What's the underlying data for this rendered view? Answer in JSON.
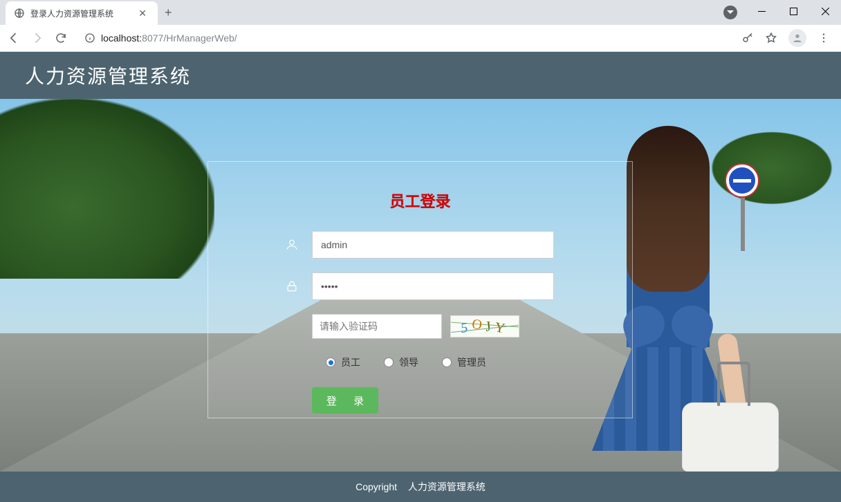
{
  "browser": {
    "tab_title": "登录人力资源管理系统",
    "url_host": "localhost:",
    "url_port": "8077",
    "url_path": "/HrManagerWeb/"
  },
  "header": {
    "title": "人力资源管理系统"
  },
  "login": {
    "title": "员工登录",
    "username_value": "admin",
    "password_value": "•••••",
    "captcha_placeholder": "请输入验证码",
    "captcha_text": "5OJY",
    "roles": {
      "employee": "员工",
      "leader": "领导",
      "admin": "管理员"
    },
    "selected_role": "employee",
    "submit_label": "登 录"
  },
  "footer": {
    "copyright": "Copyright",
    "system_name": "人力资源管理系统"
  }
}
